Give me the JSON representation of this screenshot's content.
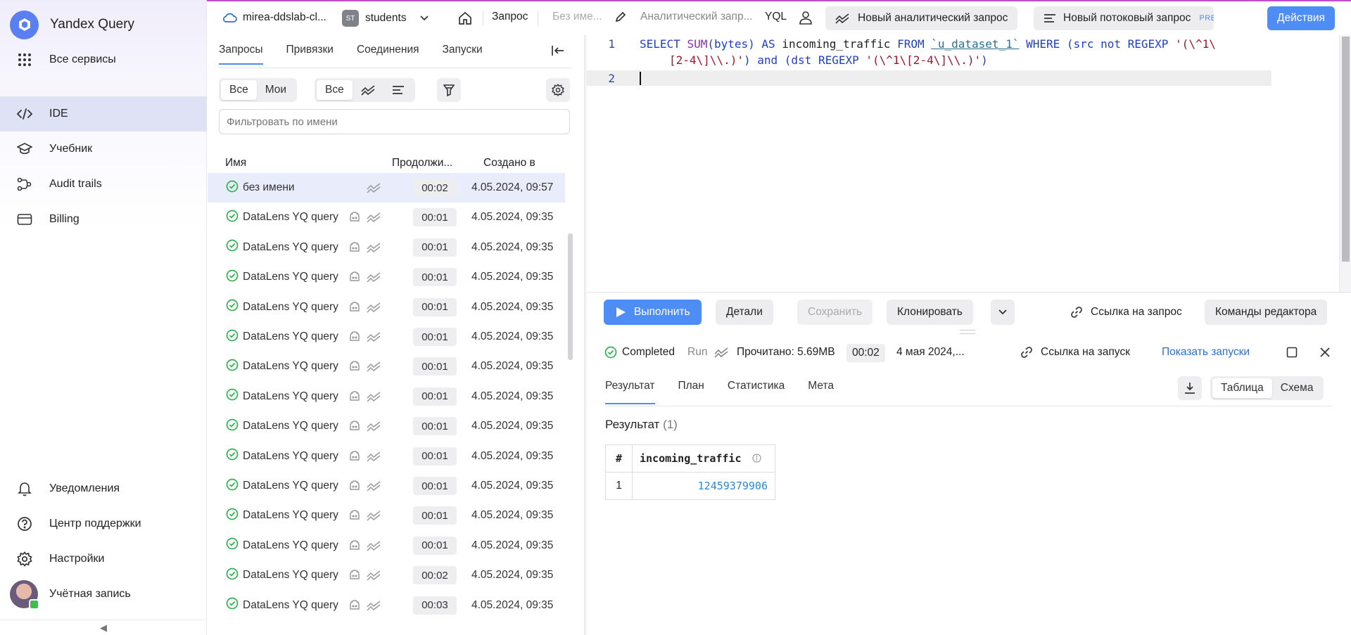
{
  "app": {
    "brand": "Yandex Query",
    "all_services": "Все сервисы"
  },
  "leftnav": {
    "items": [
      {
        "label": "IDE",
        "icon": "code-icon",
        "active": true
      },
      {
        "label": "Учебник",
        "icon": "graduation-cap-icon"
      },
      {
        "label": "Audit trails",
        "icon": "audit-trails-icon"
      },
      {
        "label": "Billing",
        "icon": "credit-card-icon"
      }
    ],
    "bottom": [
      {
        "label": "Уведомления",
        "icon": "bell-icon"
      },
      {
        "label": "Центр поддержки",
        "icon": "help-circle-icon"
      },
      {
        "label": "Настройки",
        "icon": "gear-icon"
      },
      {
        "label": "Учётная запись",
        "icon": "avatar"
      }
    ],
    "collapse_glyph": "◀"
  },
  "header": {
    "cloud": "mirea-ddslab-cl...",
    "folder_badge": "ST",
    "folder": "students",
    "query_label": "Запрос",
    "query_name": "Без име...",
    "query_type": "Аналитический запр...",
    "syntax": "YQL",
    "new_analytic": "Новый аналитический запрос",
    "new_stream": "Новый потоковый запрос",
    "preview": "PREVIEW",
    "actions": "Действия"
  },
  "midpanel": {
    "tabs": [
      "Запросы",
      "Привязки",
      "Соединения",
      "Запуски"
    ],
    "seg1": [
      "Все",
      "Мои"
    ],
    "seg2_all": "Все",
    "filter_placeholder": "Фильтровать по имени",
    "columns": {
      "name": "Имя",
      "duration": "Продолжи...",
      "created": "Создано в"
    },
    "rows": [
      {
        "name": "без имени",
        "duration": "00:02",
        "created": "4.05.2024, 09:57",
        "bot": false,
        "selected": true
      },
      {
        "name": "DataLens YQ query",
        "duration": "00:01",
        "created": "4.05.2024, 09:35",
        "bot": true
      },
      {
        "name": "DataLens YQ query",
        "duration": "00:01",
        "created": "4.05.2024, 09:35",
        "bot": true
      },
      {
        "name": "DataLens YQ query",
        "duration": "00:01",
        "created": "4.05.2024, 09:35",
        "bot": true
      },
      {
        "name": "DataLens YQ query",
        "duration": "00:01",
        "created": "4.05.2024, 09:35",
        "bot": true
      },
      {
        "name": "DataLens YQ query",
        "duration": "00:01",
        "created": "4.05.2024, 09:35",
        "bot": true
      },
      {
        "name": "DataLens YQ query",
        "duration": "00:01",
        "created": "4.05.2024, 09:35",
        "bot": true
      },
      {
        "name": "DataLens YQ query",
        "duration": "00:01",
        "created": "4.05.2024, 09:35",
        "bot": true
      },
      {
        "name": "DataLens YQ query",
        "duration": "00:01",
        "created": "4.05.2024, 09:35",
        "bot": true
      },
      {
        "name": "DataLens YQ query",
        "duration": "00:01",
        "created": "4.05.2024, 09:35",
        "bot": true
      },
      {
        "name": "DataLens YQ query",
        "duration": "00:01",
        "created": "4.05.2024, 09:35",
        "bot": true
      },
      {
        "name": "DataLens YQ query",
        "duration": "00:01",
        "created": "4.05.2024, 09:35",
        "bot": true
      },
      {
        "name": "DataLens YQ query",
        "duration": "00:01",
        "created": "4.05.2024, 09:35",
        "bot": true
      },
      {
        "name": "DataLens YQ query",
        "duration": "00:02",
        "created": "4.05.2024, 09:35",
        "bot": true
      },
      {
        "name": "DataLens YQ query",
        "duration": "00:03",
        "created": "4.05.2024, 09:35",
        "bot": true
      }
    ]
  },
  "editor": {
    "line_numbers": [
      "1",
      "2"
    ],
    "line1": {
      "p1": "SELECT ",
      "p2": "SUM",
      "p3": "(bytes) ",
      "p4": "AS",
      "p5": " incoming_traffic ",
      "p6": "FROM",
      "p7": " ",
      "p8": "`u_dataset_1`",
      "p9": " ",
      "p10": "WHERE",
      "p11": " (src ",
      "p12": "not REGEXP",
      "p13": " ",
      "p14": "'(\\^1\\",
      "w1": "[2-4\\]\\\\.)'",
      "w2": ") ",
      "w3": "and",
      "w4": " (dst ",
      "w5": "REGEXP",
      "w6": " ",
      "w7": "'(\\^1\\[2-4\\]\\\\.)'",
      "w8": ")"
    }
  },
  "toolbar": {
    "run": "Выполнить",
    "details": "Детали",
    "save": "Сохранить",
    "clone": "Клонировать",
    "query_link": "Ссылка на запрос",
    "editor_commands": "Команды редактора"
  },
  "run": {
    "status": "Completed",
    "mode": "Run",
    "read": "Прочитано: 5.69MB",
    "duration": "00:02",
    "date": "4 мая 2024,...",
    "run_link": "Ссылка на запуск",
    "show_runs": "Показать запуски"
  },
  "results": {
    "tabs": [
      "Результат",
      "План",
      "Статистика",
      "Мета"
    ],
    "view": [
      "Таблица",
      "Схема"
    ],
    "title": "Результат",
    "count": "(1)",
    "columns": [
      "#",
      "incoming_traffic"
    ],
    "rows": [
      [
        "1",
        "12459379906"
      ]
    ]
  },
  "colors": {
    "accent": "#4d8df5",
    "success": "#2fb14f",
    "active_nav": "#dfe2f5"
  }
}
